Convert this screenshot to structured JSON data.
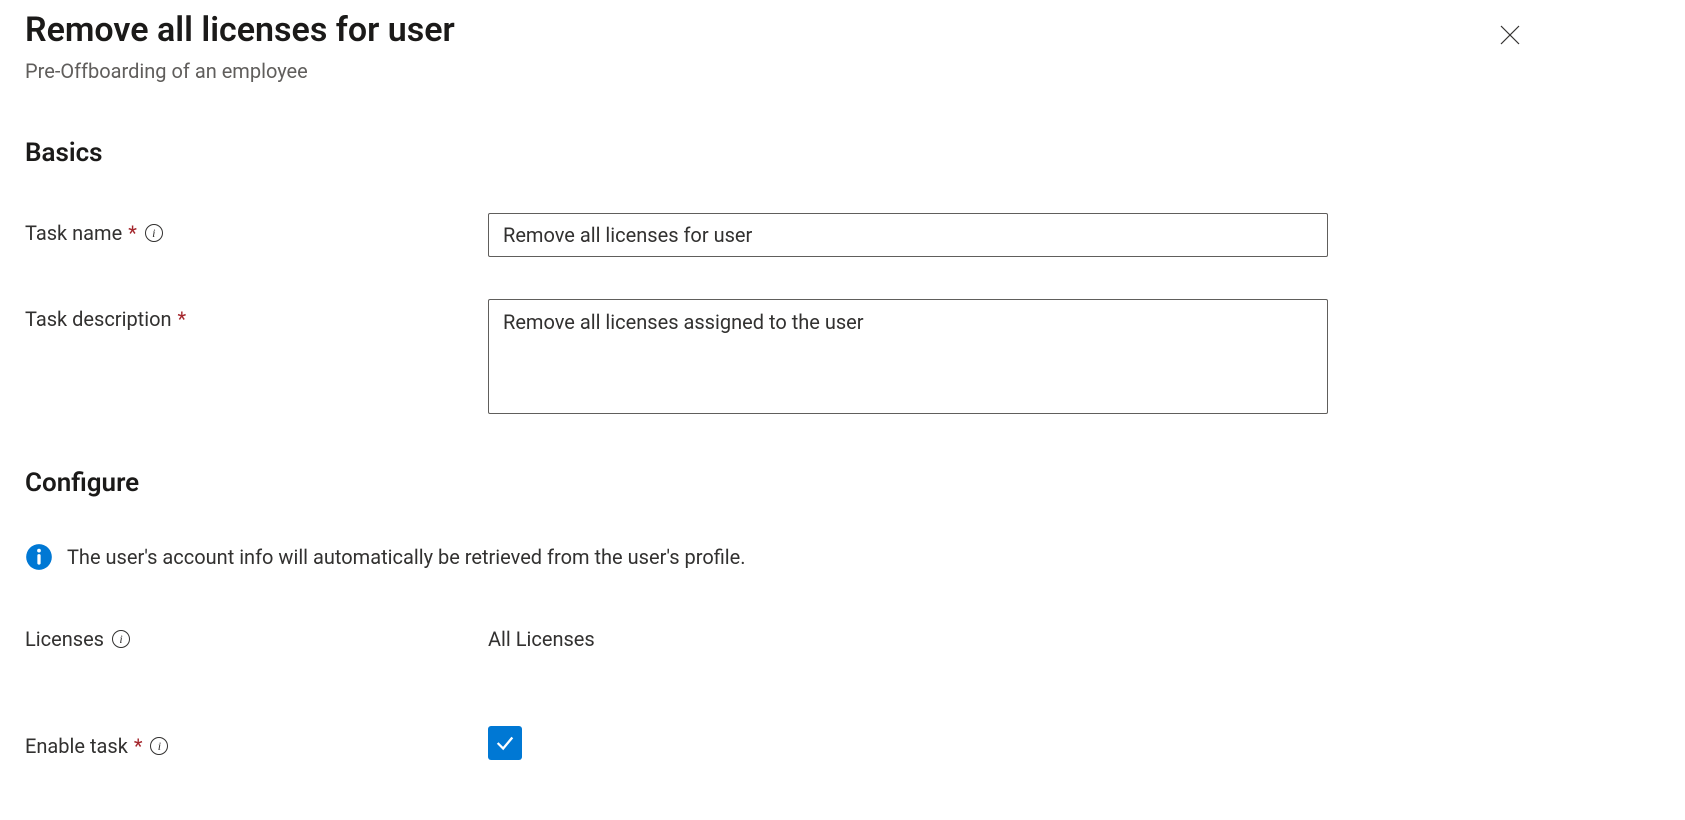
{
  "header": {
    "title": "Remove all licenses for user",
    "subtitle": "Pre-Offboarding of an employee"
  },
  "sections": {
    "basics": "Basics",
    "configure": "Configure"
  },
  "fields": {
    "task_name": {
      "label": "Task name",
      "value": "Remove all licenses for user"
    },
    "task_description": {
      "label": "Task description",
      "value": "Remove all licenses assigned to the user"
    },
    "licenses": {
      "label": "Licenses",
      "value": "All Licenses"
    },
    "enable_task": {
      "label": "Enable task",
      "checked": true
    }
  },
  "info_banner": "The user's account info will automatically be retrieved from the user's profile."
}
